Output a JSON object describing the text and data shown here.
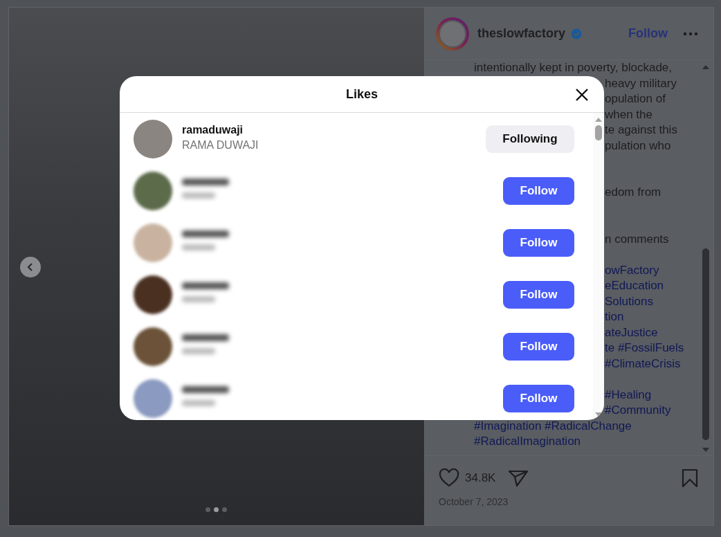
{
  "post": {
    "slides": [
      {
        "selected": false
      },
      {
        "selected": true
      },
      {
        "selected": false
      }
    ]
  },
  "header": {
    "username": "theslowfactory",
    "verified": true,
    "follow": "Follow"
  },
  "caption": [
    {
      "text": "intentionally kept in poverty, blockade,",
      "covered": false,
      "kind": "text"
    },
    {
      "text": "heavy military",
      "covered": true,
      "kind": "text"
    },
    {
      "text": "opulation of",
      "covered": true,
      "kind": "text"
    },
    {
      "text": "when the",
      "covered": true,
      "kind": "text"
    },
    {
      "text": "te against this",
      "covered": true,
      "kind": "text"
    },
    {
      "text": "pulation who",
      "covered": true,
      "kind": "text"
    },
    {
      "kind": "blank"
    },
    {
      "kind": "blank"
    },
    {
      "text": "edom from",
      "covered": true,
      "kind": "text"
    },
    {
      "kind": "blank"
    },
    {
      "kind": "blank"
    },
    {
      "text": "n comments",
      "covered": true,
      "kind": "text"
    },
    {
      "kind": "blank"
    },
    {
      "text": "owFactory",
      "covered": true,
      "kind": "tags"
    },
    {
      "text": "eEducation",
      "covered": true,
      "kind": "tags"
    },
    {
      "text": "Solutions",
      "covered": true,
      "kind": "tags"
    },
    {
      "text": "tion",
      "covered": true,
      "kind": "tags"
    },
    {
      "text": "ateJustice",
      "covered": true,
      "kind": "tags"
    },
    {
      "text": "te #FossilFuels",
      "covered": true,
      "kind": "tags"
    },
    {
      "text": "#ClimateCrisis",
      "covered": true,
      "kind": "tags"
    },
    {
      "kind": "blank"
    },
    {
      "text": "#Healing",
      "covered": true,
      "kind": "tags"
    },
    {
      "text": "#Community",
      "covered": true,
      "kind": "tags"
    },
    {
      "text": "#Imagination #RadicalChange",
      "covered": false,
      "kind": "tags"
    },
    {
      "text": "#RadicalImagination",
      "covered": false,
      "kind": "tags"
    }
  ],
  "footer": {
    "likes": "34.8K",
    "date": "October 7, 2023"
  },
  "likes_dialog": {
    "title": "Likes",
    "users": [
      {
        "blurred": false,
        "username": "ramaduwaji",
        "full_name": "RAMA DUWAJI",
        "following": true,
        "button": "Following"
      },
      {
        "blurred": true,
        "following": false,
        "button": "Follow"
      },
      {
        "blurred": true,
        "following": false,
        "button": "Follow"
      },
      {
        "blurred": true,
        "following": false,
        "button": "Follow"
      },
      {
        "blurred": true,
        "following": false,
        "button": "Follow"
      },
      {
        "blurred": true,
        "following": false,
        "button": "Follow"
      }
    ]
  }
}
